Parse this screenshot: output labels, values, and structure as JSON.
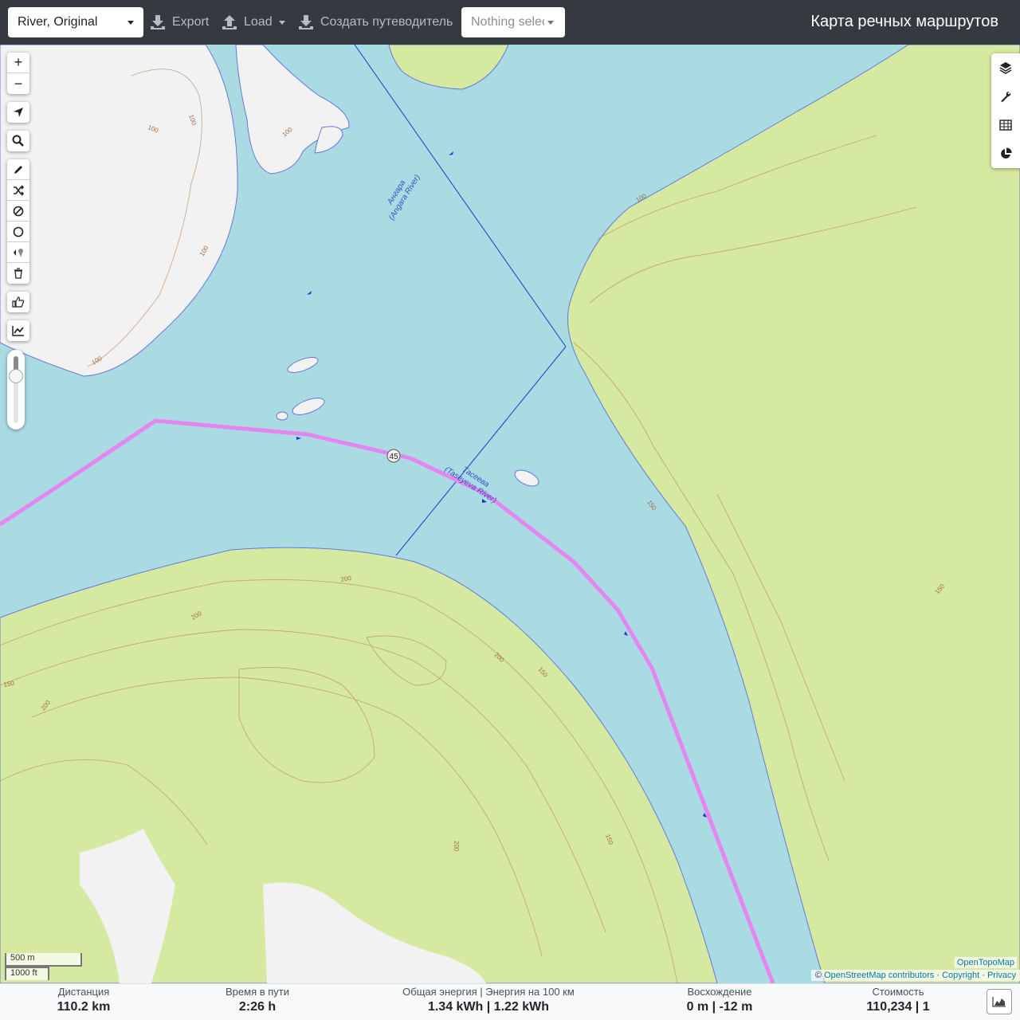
{
  "header": {
    "profile": "River, Original",
    "export_label": "Export",
    "load_label": "Load",
    "guide_label": "Создать путеводитель",
    "nothing_selected": "Nothing selected",
    "title": "Карта речных маршрутов"
  },
  "map": {
    "river_labels": [
      {
        "line1": "Ангара",
        "line2": "(Angara River)"
      },
      {
        "line1": "Тасеева",
        "line2": "(Taseyeva River)"
      }
    ],
    "route_marker": "45",
    "contours": [
      "100",
      "100",
      "100",
      "100",
      "100",
      "100",
      "150",
      "200",
      "200",
      "150",
      "200",
      "150",
      "200",
      "150",
      "150",
      "200"
    ],
    "colors": {
      "water": "#aadbe3",
      "forest": "#d5eaa0",
      "land": "#f2f2f2",
      "route": "#e486f0",
      "contour": "#c08a60"
    }
  },
  "left_controls": {
    "zoom_in": "+",
    "zoom_out": "−",
    "icons": [
      "locate-icon",
      "search-icon",
      "pencil-icon",
      "shuffle-icon",
      "no-entry-icon",
      "circle-icon",
      "poi-icon",
      "trash-icon",
      "thumbs-up-icon",
      "chart-icon"
    ]
  },
  "right_controls": [
    "layers-icon",
    "wrench-icon",
    "table-icon",
    "pie-chart-icon"
  ],
  "scale": {
    "metric": "500 m",
    "imperial": "1000 ft"
  },
  "attribution": {
    "layer": "OpenTopoMap",
    "prefix": "©",
    "osm": "OpenStreetMap contributors",
    "sep1": "·",
    "copyright": "Copyright",
    "sep2": "·",
    "privacy": "Privacy"
  },
  "stats": {
    "distance": {
      "label": "Дистанция",
      "value": "110.2 km"
    },
    "time": {
      "label": "Время в пути",
      "value": "2:26 h"
    },
    "energy": {
      "label": "Общая энергия | Энергия на 100 км",
      "value": "1.34 kWh | 1.22 kWh"
    },
    "ascent": {
      "label": "Восхождение",
      "value": "0 m | -12 m"
    },
    "cost": {
      "label": "Стоимость",
      "value": "110,234 | 1"
    }
  }
}
